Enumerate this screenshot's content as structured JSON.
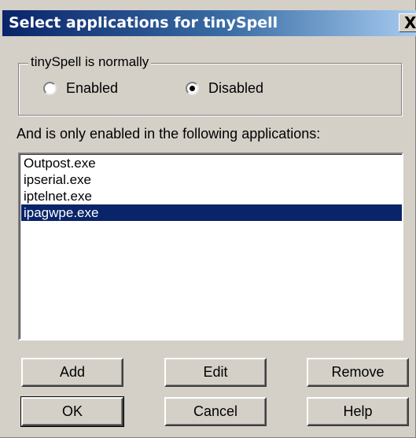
{
  "window": {
    "title": "Select applications for tinySpell",
    "close_glyph": "X"
  },
  "state_group": {
    "label": "tinySpell is normally",
    "options": [
      {
        "label": "Enabled",
        "selected": false
      },
      {
        "label": "Disabled",
        "selected": true
      }
    ]
  },
  "apps": {
    "caption": "And is only enabled in the following applications:",
    "items": [
      "Outpost.exe",
      "ipserial.exe",
      "iptelnet.exe",
      "ipagwpe.exe"
    ],
    "selected_index": 3
  },
  "buttons": {
    "add": "Add",
    "edit": "Edit",
    "remove": "Remove",
    "ok": "OK",
    "cancel": "Cancel",
    "help": "Help"
  },
  "colors": {
    "title_bar": "#0a246a",
    "selection": "#0a246a",
    "face": "#d4d0c8"
  }
}
